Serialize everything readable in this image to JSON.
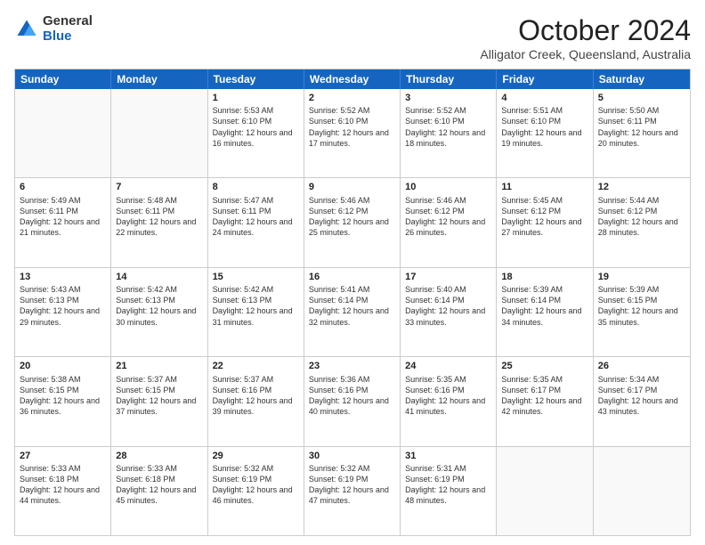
{
  "logo": {
    "general": "General",
    "blue": "Blue"
  },
  "title": {
    "month": "October 2024",
    "location": "Alligator Creek, Queensland, Australia"
  },
  "days_of_week": [
    "Sunday",
    "Monday",
    "Tuesday",
    "Wednesday",
    "Thursday",
    "Friday",
    "Saturday"
  ],
  "weeks": [
    [
      {
        "day": "",
        "info": ""
      },
      {
        "day": "",
        "info": ""
      },
      {
        "day": "1",
        "info": "Sunrise: 5:53 AM\nSunset: 6:10 PM\nDaylight: 12 hours and 16 minutes."
      },
      {
        "day": "2",
        "info": "Sunrise: 5:52 AM\nSunset: 6:10 PM\nDaylight: 12 hours and 17 minutes."
      },
      {
        "day": "3",
        "info": "Sunrise: 5:52 AM\nSunset: 6:10 PM\nDaylight: 12 hours and 18 minutes."
      },
      {
        "day": "4",
        "info": "Sunrise: 5:51 AM\nSunset: 6:10 PM\nDaylight: 12 hours and 19 minutes."
      },
      {
        "day": "5",
        "info": "Sunrise: 5:50 AM\nSunset: 6:11 PM\nDaylight: 12 hours and 20 minutes."
      }
    ],
    [
      {
        "day": "6",
        "info": "Sunrise: 5:49 AM\nSunset: 6:11 PM\nDaylight: 12 hours and 21 minutes."
      },
      {
        "day": "7",
        "info": "Sunrise: 5:48 AM\nSunset: 6:11 PM\nDaylight: 12 hours and 22 minutes."
      },
      {
        "day": "8",
        "info": "Sunrise: 5:47 AM\nSunset: 6:11 PM\nDaylight: 12 hours and 24 minutes."
      },
      {
        "day": "9",
        "info": "Sunrise: 5:46 AM\nSunset: 6:12 PM\nDaylight: 12 hours and 25 minutes."
      },
      {
        "day": "10",
        "info": "Sunrise: 5:46 AM\nSunset: 6:12 PM\nDaylight: 12 hours and 26 minutes."
      },
      {
        "day": "11",
        "info": "Sunrise: 5:45 AM\nSunset: 6:12 PM\nDaylight: 12 hours and 27 minutes."
      },
      {
        "day": "12",
        "info": "Sunrise: 5:44 AM\nSunset: 6:12 PM\nDaylight: 12 hours and 28 minutes."
      }
    ],
    [
      {
        "day": "13",
        "info": "Sunrise: 5:43 AM\nSunset: 6:13 PM\nDaylight: 12 hours and 29 minutes."
      },
      {
        "day": "14",
        "info": "Sunrise: 5:42 AM\nSunset: 6:13 PM\nDaylight: 12 hours and 30 minutes."
      },
      {
        "day": "15",
        "info": "Sunrise: 5:42 AM\nSunset: 6:13 PM\nDaylight: 12 hours and 31 minutes."
      },
      {
        "day": "16",
        "info": "Sunrise: 5:41 AM\nSunset: 6:14 PM\nDaylight: 12 hours and 32 minutes."
      },
      {
        "day": "17",
        "info": "Sunrise: 5:40 AM\nSunset: 6:14 PM\nDaylight: 12 hours and 33 minutes."
      },
      {
        "day": "18",
        "info": "Sunrise: 5:39 AM\nSunset: 6:14 PM\nDaylight: 12 hours and 34 minutes."
      },
      {
        "day": "19",
        "info": "Sunrise: 5:39 AM\nSunset: 6:15 PM\nDaylight: 12 hours and 35 minutes."
      }
    ],
    [
      {
        "day": "20",
        "info": "Sunrise: 5:38 AM\nSunset: 6:15 PM\nDaylight: 12 hours and 36 minutes."
      },
      {
        "day": "21",
        "info": "Sunrise: 5:37 AM\nSunset: 6:15 PM\nDaylight: 12 hours and 37 minutes."
      },
      {
        "day": "22",
        "info": "Sunrise: 5:37 AM\nSunset: 6:16 PM\nDaylight: 12 hours and 39 minutes."
      },
      {
        "day": "23",
        "info": "Sunrise: 5:36 AM\nSunset: 6:16 PM\nDaylight: 12 hours and 40 minutes."
      },
      {
        "day": "24",
        "info": "Sunrise: 5:35 AM\nSunset: 6:16 PM\nDaylight: 12 hours and 41 minutes."
      },
      {
        "day": "25",
        "info": "Sunrise: 5:35 AM\nSunset: 6:17 PM\nDaylight: 12 hours and 42 minutes."
      },
      {
        "day": "26",
        "info": "Sunrise: 5:34 AM\nSunset: 6:17 PM\nDaylight: 12 hours and 43 minutes."
      }
    ],
    [
      {
        "day": "27",
        "info": "Sunrise: 5:33 AM\nSunset: 6:18 PM\nDaylight: 12 hours and 44 minutes."
      },
      {
        "day": "28",
        "info": "Sunrise: 5:33 AM\nSunset: 6:18 PM\nDaylight: 12 hours and 45 minutes."
      },
      {
        "day": "29",
        "info": "Sunrise: 5:32 AM\nSunset: 6:19 PM\nDaylight: 12 hours and 46 minutes."
      },
      {
        "day": "30",
        "info": "Sunrise: 5:32 AM\nSunset: 6:19 PM\nDaylight: 12 hours and 47 minutes."
      },
      {
        "day": "31",
        "info": "Sunrise: 5:31 AM\nSunset: 6:19 PM\nDaylight: 12 hours and 48 minutes."
      },
      {
        "day": "",
        "info": ""
      },
      {
        "day": "",
        "info": ""
      }
    ]
  ]
}
